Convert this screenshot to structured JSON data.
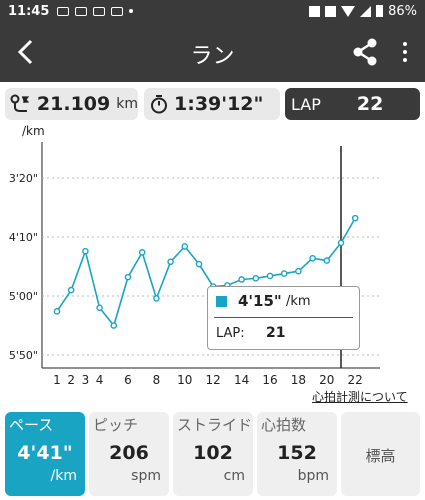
{
  "status": {
    "time": "11:45",
    "battery": "86%"
  },
  "appbar": {
    "title": "ラン"
  },
  "stats": {
    "distance": "21.109",
    "distance_unit": "km",
    "duration": "1:39'12\"",
    "lap_label": "LAP",
    "lap_value": "22"
  },
  "chart_data": {
    "type": "line",
    "ylabel": "/km",
    "y_ticks": [
      "3'20\"",
      "4'10\"",
      "5'00\"",
      "5'50\""
    ],
    "y_tick_seconds": [
      200,
      250,
      300,
      350
    ],
    "y_inverted": true,
    "x_ticks": [
      "1",
      "2",
      "4",
      "6",
      "8",
      "10",
      "12",
      "14",
      "16",
      "18",
      "20",
      "22"
    ],
    "x_tick_positions": [
      1,
      2,
      4,
      6,
      8,
      10,
      12,
      14,
      16,
      18,
      20,
      22
    ],
    "x_label_extra": "3",
    "x": [
      1,
      2,
      3,
      4,
      5,
      6,
      7,
      8,
      9,
      10,
      11,
      12,
      13,
      14,
      15,
      16,
      17,
      18,
      19,
      20,
      21,
      22
    ],
    "values_seconds": [
      313,
      295,
      262,
      310,
      325,
      284,
      263,
      302,
      271,
      258,
      273,
      292,
      291,
      286,
      285,
      283,
      281,
      279,
      268,
      270,
      255,
      234
    ],
    "selected_lap": 21,
    "grid": "horizontal dotted",
    "color": "#1aa4c4"
  },
  "tooltip": {
    "pace": "4'15\"",
    "pace_unit": "/km",
    "lap_label": "LAP:",
    "lap_value": "21"
  },
  "link": {
    "about_hr": "心拍計測について"
  },
  "tabs": [
    {
      "name": "ペース",
      "value": "4'41\"",
      "unit": "/km"
    },
    {
      "name": "ピッチ",
      "value": "206",
      "unit": "spm"
    },
    {
      "name": "ストライド",
      "value": "102",
      "unit": "cm"
    },
    {
      "name": "心拍数",
      "value": "152",
      "unit": "bpm"
    },
    {
      "name": "標高",
      "value": "",
      "unit": ""
    }
  ],
  "colors": {
    "accent": "#1aa4c4",
    "header": "#3a3a3a"
  }
}
